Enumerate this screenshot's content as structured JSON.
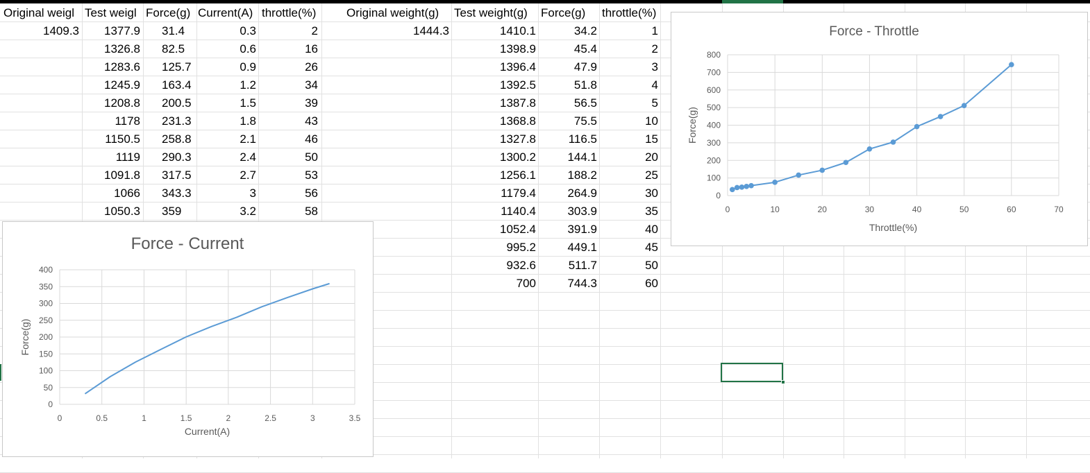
{
  "table1": {
    "headers": [
      "Original weigl",
      "Test weigl",
      "Force(g)",
      "Current(A)",
      "throttle(%)"
    ],
    "original_weight": "1409.3",
    "rows": [
      [
        "1377.9",
        "31.4",
        "0.3",
        "2"
      ],
      [
        "1326.8",
        "82.5",
        "0.6",
        "16"
      ],
      [
        "1283.6",
        "125.7",
        "0.9",
        "26"
      ],
      [
        "1245.9",
        "163.4",
        "1.2",
        "34"
      ],
      [
        "1208.8",
        "200.5",
        "1.5",
        "39"
      ],
      [
        "1178",
        "231.3",
        "1.8",
        "43"
      ],
      [
        "1150.5",
        "258.8",
        "2.1",
        "46"
      ],
      [
        "1119",
        "290.3",
        "2.4",
        "50"
      ],
      [
        "1091.8",
        "317.5",
        "2.7",
        "53"
      ],
      [
        "1066",
        "343.3",
        "3",
        "56"
      ],
      [
        "1050.3",
        "359",
        "3.2",
        "58"
      ]
    ]
  },
  "table2": {
    "headers": [
      "Original weight(g)",
      "Test weight(g)",
      "Force(g)",
      "throttle(%)"
    ],
    "original_weight": "1444.3",
    "rows": [
      [
        "1410.1",
        "34.2",
        "1"
      ],
      [
        "1398.9",
        "45.4",
        "2"
      ],
      [
        "1396.4",
        "47.9",
        "3"
      ],
      [
        "1392.5",
        "51.8",
        "4"
      ],
      [
        "1387.8",
        "56.5",
        "5"
      ],
      [
        "1368.8",
        "75.5",
        "10"
      ],
      [
        "1327.8",
        "116.5",
        "15"
      ],
      [
        "1300.2",
        "144.1",
        "20"
      ],
      [
        "1256.1",
        "188.2",
        "25"
      ],
      [
        "1179.4",
        "264.9",
        "30"
      ],
      [
        "1140.4",
        "303.9",
        "35"
      ],
      [
        "1052.4",
        "391.9",
        "40"
      ],
      [
        "995.2",
        "449.1",
        "45"
      ],
      [
        "932.6",
        "511.7",
        "50"
      ],
      [
        "700",
        "744.3",
        "60"
      ]
    ]
  },
  "colors": {
    "series": "#5b9bd5",
    "selection": "#217346",
    "gridline": "#e1e1e1"
  },
  "chart_data": [
    {
      "type": "line",
      "title": "Force - Current",
      "xlabel": "Current(A)",
      "ylabel": "Force(g)",
      "xlim": [
        0,
        3.5
      ],
      "ylim": [
        0,
        400
      ],
      "xticks": [
        "0",
        "0.5",
        "1",
        "1.5",
        "2",
        "2.5",
        "3",
        "3.5"
      ],
      "yticks": [
        "0",
        "50",
        "100",
        "150",
        "200",
        "250",
        "300",
        "350",
        "400"
      ],
      "grid": true,
      "markers": false,
      "x": [
        0.3,
        0.6,
        0.9,
        1.2,
        1.5,
        1.8,
        2.1,
        2.4,
        2.7,
        3,
        3.2
      ],
      "y": [
        31.4,
        82.5,
        125.7,
        163.4,
        200.5,
        231.3,
        258.8,
        290.3,
        317.5,
        343.3,
        359
      ]
    },
    {
      "type": "scatter",
      "title": "Force - Throttle",
      "xlabel": "Throttle(%)",
      "ylabel": "Force(g)",
      "xlim": [
        0,
        70
      ],
      "ylim": [
        0,
        800
      ],
      "xticks": [
        "0",
        "10",
        "20",
        "30",
        "40",
        "50",
        "60",
        "70"
      ],
      "yticks": [
        "0",
        "100",
        "200",
        "300",
        "400",
        "500",
        "600",
        "700",
        "800"
      ],
      "grid": true,
      "markers": true,
      "x": [
        1,
        2,
        3,
        4,
        5,
        10,
        15,
        20,
        25,
        30,
        35,
        40,
        45,
        50,
        60
      ],
      "y": [
        34.2,
        45.4,
        47.9,
        51.8,
        56.5,
        75.5,
        116.5,
        144.1,
        188.2,
        264.9,
        303.9,
        391.9,
        449.1,
        511.7,
        744.3
      ]
    }
  ]
}
